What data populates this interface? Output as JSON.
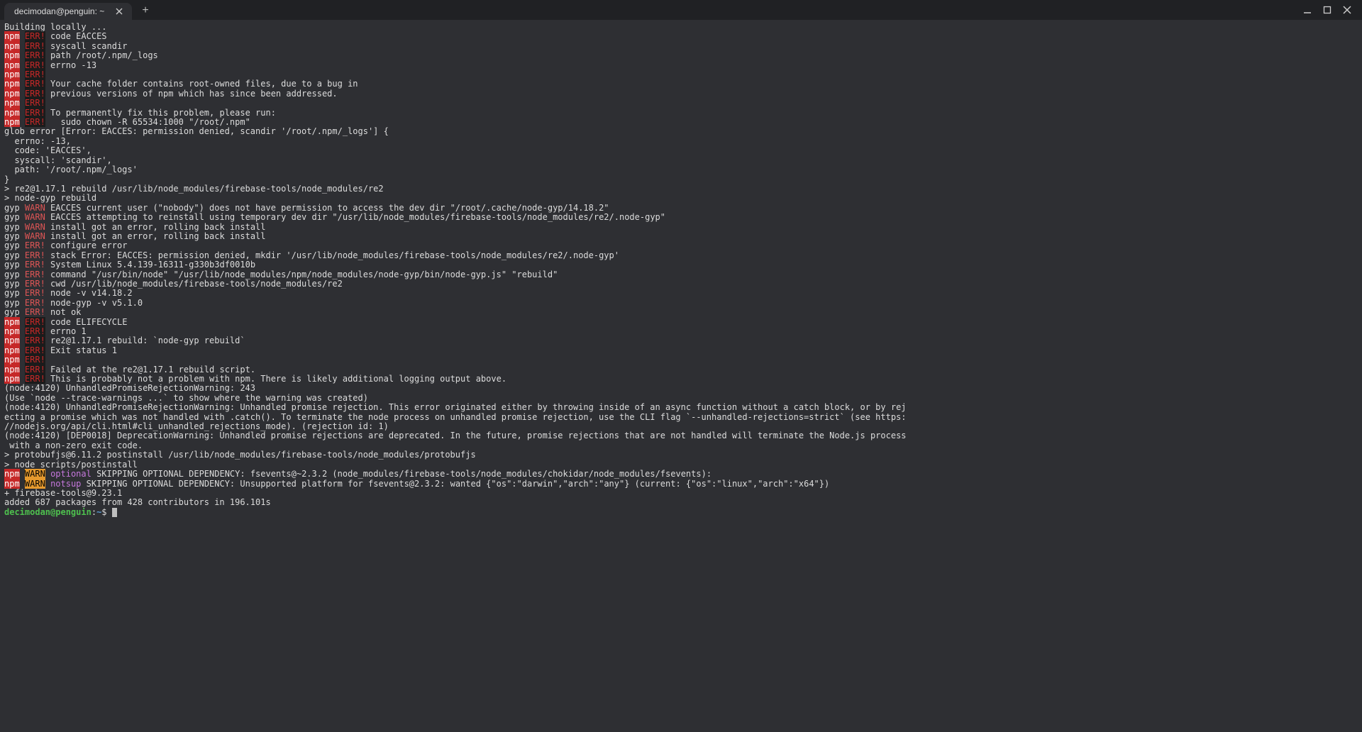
{
  "tab": {
    "title": "decimodan@penguin: ~"
  },
  "prompt": {
    "user_host": "decimodan@penguin",
    "sep": ":",
    "path": "~",
    "suffix": "$"
  },
  "lines": [
    {
      "t": "plain",
      "text": "Building locally ..."
    },
    {
      "t": "npmerr",
      "text": "code EACCES"
    },
    {
      "t": "npmerr",
      "text": "syscall scandir"
    },
    {
      "t": "npmerr",
      "text": "path /root/.npm/_logs"
    },
    {
      "t": "npmerr",
      "text": "errno -13"
    },
    {
      "t": "npmerr",
      "text": ""
    },
    {
      "t": "npmerr",
      "text": "Your cache folder contains root-owned files, due to a bug in"
    },
    {
      "t": "npmerr",
      "text": "previous versions of npm which has since been addressed."
    },
    {
      "t": "npmerr",
      "text": ""
    },
    {
      "t": "npmerr",
      "text": "To permanently fix this problem, please run:"
    },
    {
      "t": "npmerr",
      "text": "  sudo chown -R 65534:1000 \"/root/.npm\""
    },
    {
      "t": "plain",
      "text": "glob error [Error: EACCES: permission denied, scandir '/root/.npm/_logs'] {"
    },
    {
      "t": "plain",
      "text": "  errno: -13,"
    },
    {
      "t": "plain",
      "text": "  code: 'EACCES',"
    },
    {
      "t": "plain",
      "text": "  syscall: 'scandir',"
    },
    {
      "t": "plain",
      "text": "  path: '/root/.npm/_logs'"
    },
    {
      "t": "plain",
      "text": "}"
    },
    {
      "t": "plain",
      "text": ""
    },
    {
      "t": "plain",
      "text": "> re2@1.17.1 rebuild /usr/lib/node_modules/firebase-tools/node_modules/re2"
    },
    {
      "t": "plain",
      "text": "> node-gyp rebuild"
    },
    {
      "t": "plain",
      "text": ""
    },
    {
      "t": "gypwarn",
      "text": "EACCES current user (\"nobody\") does not have permission to access the dev dir \"/root/.cache/node-gyp/14.18.2\""
    },
    {
      "t": "gypwarn",
      "text": "EACCES attempting to reinstall using temporary dev dir \"/usr/lib/node_modules/firebase-tools/node_modules/re2/.node-gyp\""
    },
    {
      "t": "gypwarn",
      "text": "install got an error, rolling back install"
    },
    {
      "t": "gypwarn",
      "text": "install got an error, rolling back install"
    },
    {
      "t": "gyperr",
      "text": "configure error"
    },
    {
      "t": "gyperr",
      "text": "stack Error: EACCES: permission denied, mkdir '/usr/lib/node_modules/firebase-tools/node_modules/re2/.node-gyp'"
    },
    {
      "t": "gyperr",
      "text": "System Linux 5.4.139-16311-g330b3df0010b"
    },
    {
      "t": "gyperr",
      "text": "command \"/usr/bin/node\" \"/usr/lib/node_modules/npm/node_modules/node-gyp/bin/node-gyp.js\" \"rebuild\""
    },
    {
      "t": "gyperr",
      "text": "cwd /usr/lib/node_modules/firebase-tools/node_modules/re2"
    },
    {
      "t": "gyperr",
      "text": "node -v v14.18.2"
    },
    {
      "t": "gyperr",
      "text": "node-gyp -v v5.1.0"
    },
    {
      "t": "gyperr",
      "text": "not ok"
    },
    {
      "t": "npmerr",
      "text": "code ELIFECYCLE"
    },
    {
      "t": "npmerr",
      "text": "errno 1"
    },
    {
      "t": "npmerr",
      "text": "re2@1.17.1 rebuild: `node-gyp rebuild`"
    },
    {
      "t": "npmerr",
      "text": "Exit status 1"
    },
    {
      "t": "npmerr",
      "text": ""
    },
    {
      "t": "npmerr",
      "text": "Failed at the re2@1.17.1 rebuild script."
    },
    {
      "t": "npmerr",
      "text": "This is probably not a problem with npm. There is likely additional logging output above."
    },
    {
      "t": "plain",
      "text": "(node:4120) UnhandledPromiseRejectionWarning: 243"
    },
    {
      "t": "plain",
      "text": "(Use `node --trace-warnings ...` to show where the warning was created)"
    },
    {
      "t": "plain",
      "text": "(node:4120) UnhandledPromiseRejectionWarning: Unhandled promise rejection. This error originated either by throwing inside of an async function without a catch block, or by rejecting a promise which was not handled with .catch(). To terminate the node process on unhandled promise rejection, use the CLI flag `--unhandled-rejections=strict` (see https://nodejs.org/api/cli.html#cli_unhandled_rejections_mode). (rejection id: 1)"
    },
    {
      "t": "plain",
      "text": "(node:4120) [DEP0018] DeprecationWarning: Unhandled promise rejections are deprecated. In the future, promise rejections that are not handled will terminate the Node.js process with a non-zero exit code."
    },
    {
      "t": "plain",
      "text": ""
    },
    {
      "t": "plain",
      "text": "> protobufjs@6.11.2 postinstall /usr/lib/node_modules/firebase-tools/node_modules/protobufjs"
    },
    {
      "t": "plain",
      "text": "> node scripts/postinstall"
    },
    {
      "t": "plain",
      "text": ""
    },
    {
      "t": "npmwarn",
      "kw": "optional",
      "text": "SKIPPING OPTIONAL DEPENDENCY: fsevents@~2.3.2 (node_modules/firebase-tools/node_modules/chokidar/node_modules/fsevents):"
    },
    {
      "t": "npmwarn",
      "kw": "notsup",
      "text": "SKIPPING OPTIONAL DEPENDENCY: Unsupported platform for fsevents@2.3.2: wanted {\"os\":\"darwin\",\"arch\":\"any\"} (current: {\"os\":\"linux\",\"arch\":\"x64\"})"
    },
    {
      "t": "plain",
      "text": ""
    },
    {
      "t": "plain",
      "text": "+ firebase-tools@9.23.1"
    },
    {
      "t": "plain",
      "text": "added 687 packages from 428 contributors in 196.101s"
    }
  ]
}
